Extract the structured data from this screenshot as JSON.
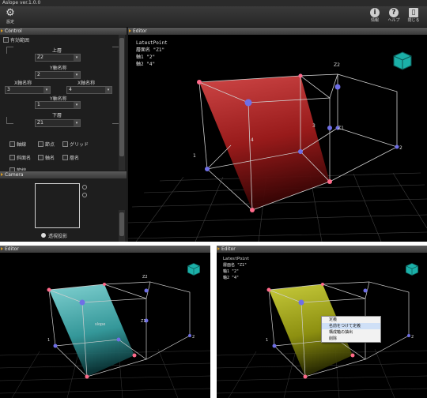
{
  "app": {
    "title": "Aslope ver.1.0.0"
  },
  "toolbar": {
    "settings": "設定",
    "info": "情報",
    "help": "ヘルプ",
    "close": "閉じる"
  },
  "control": {
    "header": "Control",
    "effective_range": "有効範囲",
    "upper_layer": "上層",
    "upper_layer_value": "Z2",
    "y_axis": "Y軸名称",
    "y_value": "2",
    "x_axis_left": "X軸名称",
    "x_axis_right": "X軸名称",
    "x_left_value": "3",
    "x_right_value": "4",
    "y_axis_lower": "Y軸名称",
    "y_lower_value": "1",
    "lower_layer": "下層",
    "lower_layer_value": "Z1",
    "cb_axis": "軸線",
    "cb_node": "節点",
    "cb_grid": "グリッド",
    "cb_slope": "斜面名",
    "cb_axisname": "軸名",
    "cb_layername": "層名",
    "cb_partial": "節線"
  },
  "camera": {
    "header": "Camera",
    "projection": "透視投影"
  },
  "editor": {
    "header": "Editor",
    "latest": "LatestPoint",
    "layer_line": "層面名 \"Z1\"",
    "axis1_line": "軸1  \"2\"",
    "axis2_line": "軸2  \"4\""
  },
  "scene": {
    "z1": "Z1",
    "z2": "Z2",
    "n1": "1",
    "n2": "2",
    "n3": "3",
    "n4": "4",
    "slope": "slope"
  },
  "context_menu": [
    "定義",
    "名前をつけて定義",
    "構成軸の抽出",
    "削除"
  ],
  "colors": {
    "slope_red": "#c0282a",
    "slope_cyan": "#66d8d8",
    "slope_yellow": "#b4b81e",
    "accent": "#d79a22"
  }
}
